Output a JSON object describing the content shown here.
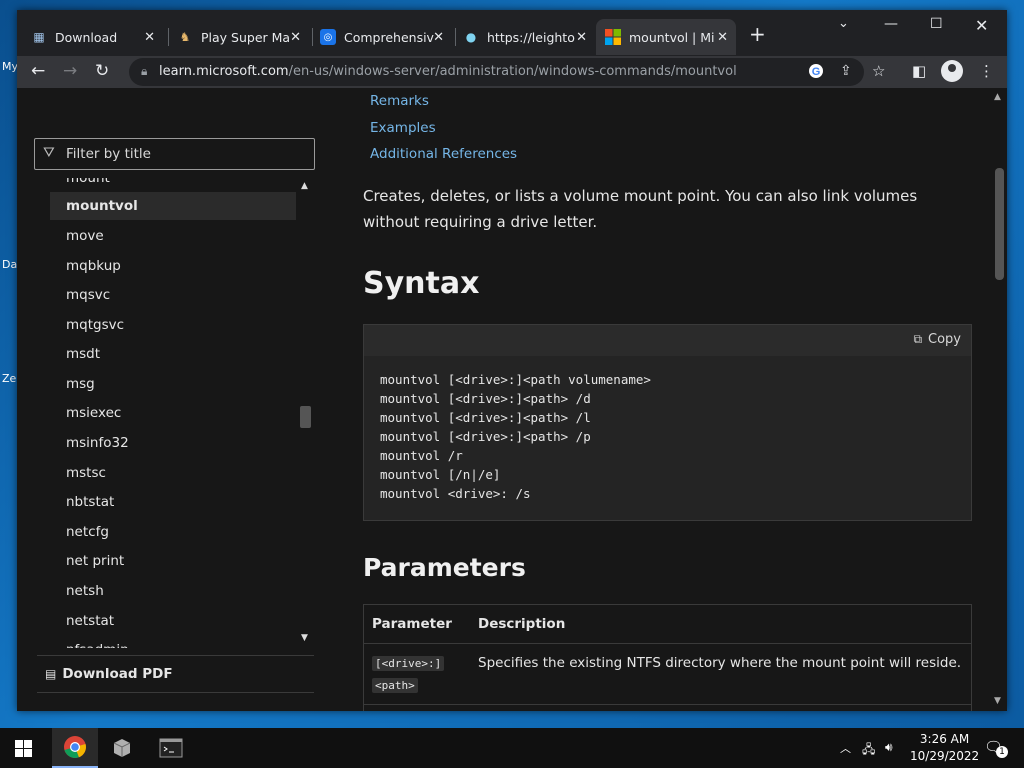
{
  "desktop": {
    "labels": [
      "My",
      "Da",
      "Ze"
    ]
  },
  "browser": {
    "tabs": [
      {
        "title": "Download",
        "favicon": "network-icon"
      },
      {
        "title": "Play Super Ma",
        "favicon": "game-icon"
      },
      {
        "title": "Comprehensiv",
        "favicon": "location-pin-icon"
      },
      {
        "title": "https://leighto",
        "favicon": "globe-icon"
      },
      {
        "title": "mountvol | Mic",
        "favicon": "microsoft-logo-icon",
        "active": true
      }
    ],
    "url_host": "learn.microsoft.com",
    "url_path": "/en-us/windows-server/administration/windows-commands/mountvol"
  },
  "sidebar": {
    "filter_placeholder": "Filter by title",
    "items": [
      "mount",
      "mountvol",
      "move",
      "mqbkup",
      "mqsvc",
      "mqtgsvc",
      "msdt",
      "msg",
      "msiexec",
      "msinfo32",
      "mstsc",
      "nbtstat",
      "netcfg",
      "net print",
      "netsh",
      "netstat",
      "nfsadmin"
    ],
    "active_index": 1,
    "download_pdf": "Download PDF"
  },
  "content": {
    "links": [
      "Remarks",
      "Examples",
      "Additional References"
    ],
    "intro": "Creates, deletes, or lists a volume mount point. You can also link volumes without requiring a drive letter.",
    "syntax_heading": "Syntax",
    "copy_label": "Copy",
    "code_lines": [
      "mountvol [<drive>:]<path volumename>",
      "mountvol [<drive>:]<path> /d",
      "mountvol [<drive>:]<path> /l",
      "mountvol [<drive>:]<path> /p",
      "mountvol /r",
      "mountvol [/n|/e]",
      "mountvol <drive>: /s"
    ],
    "parameters_heading": "Parameters",
    "table": {
      "headers": [
        "Parameter",
        "Description"
      ],
      "rows": [
        {
          "param_line1": "[<drive>:]",
          "param_line2": "<path>",
          "description": "Specifies the existing NTFS directory where the mount point will reside."
        }
      ]
    }
  },
  "taskbar": {
    "time": "3:26 AM",
    "date": "10/29/2022",
    "notification_count": "1"
  },
  "colors": {
    "page_bg": "#171717",
    "link": "#75b6e7",
    "chrome_tabstrip": "#202124",
    "chrome_toolbar": "#35363a"
  }
}
